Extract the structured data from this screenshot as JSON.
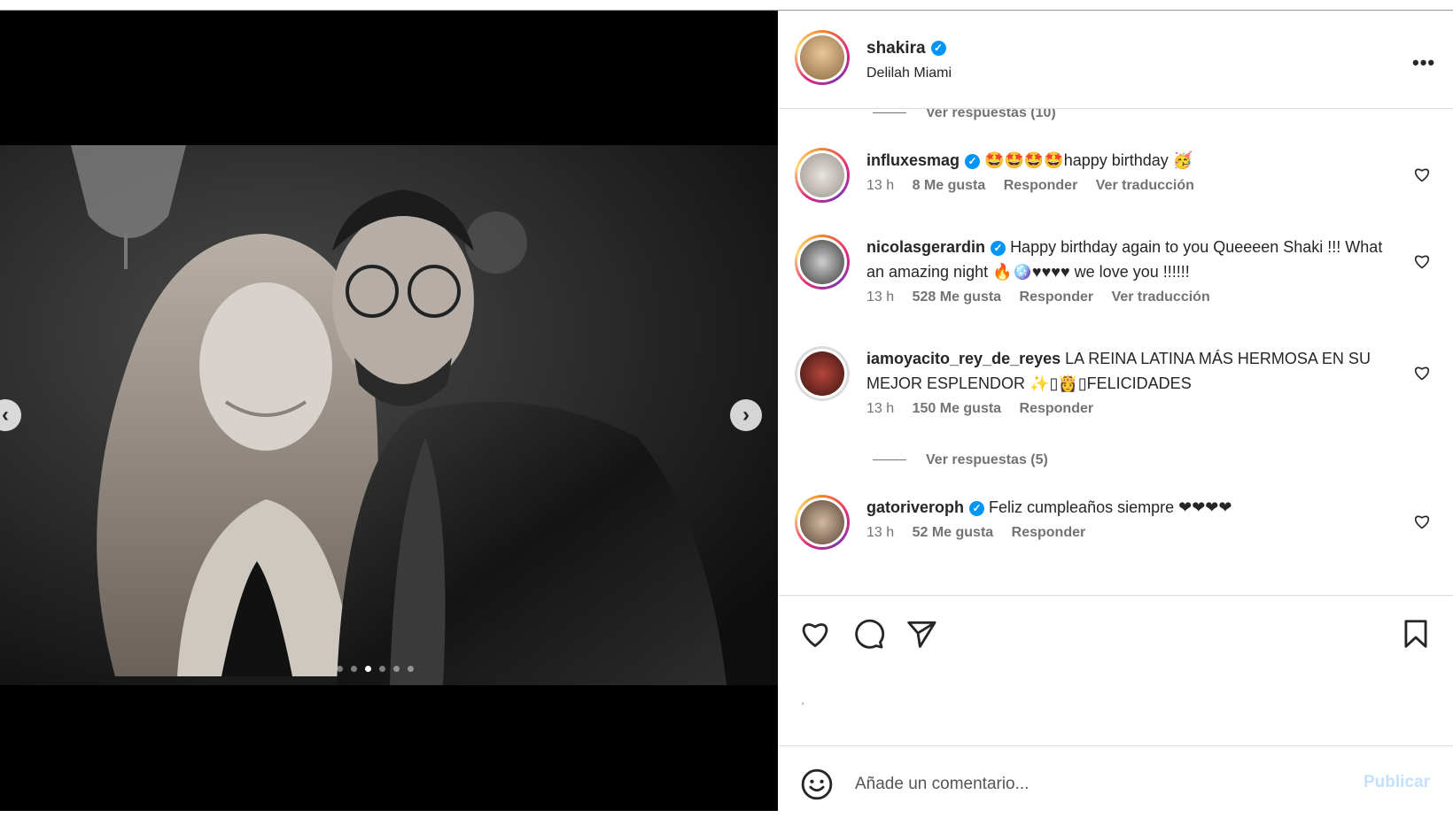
{
  "post": {
    "owner": "shakira",
    "location": "Delilah Miami",
    "more_icon": "more-options-icon",
    "carousel_dots": 6,
    "carousel_active_index": 2
  },
  "comments": {
    "prev_view_replies": "Ver respuestas (10)",
    "items": [
      {
        "user": "influxesmag",
        "verified": true,
        "text": "🤩🤩🤩🤩happy birthday 🥳",
        "time": "13 h",
        "likes": "8 Me gusta",
        "reply": "Responder",
        "translate": "Ver traducción"
      },
      {
        "user": "nicolasgerardin",
        "verified": true,
        "text": "Happy birthday again to you Queeeen Shaki !!! What an amazing night 🔥🪩♥♥♥♥ we love you !!!!!!",
        "time": "13 h",
        "likes": "528 Me gusta",
        "reply": "Responder",
        "translate": "Ver traducción"
      },
      {
        "user": "iamoyacito_rey_de_reyes",
        "verified": false,
        "text": "LA REINA LATINA MÁS HERMOSA EN SU MEJOR ESPLENDOR ✨▯👸▯FELICIDADES",
        "time": "13 h",
        "likes": "150 Me gusta",
        "reply": "Responder",
        "view_replies": "Ver respuestas (5)"
      },
      {
        "user": "gatoriveroph",
        "verified": true,
        "text": "Feliz cumpleaños siempre ❤❤❤❤",
        "time": "13 h",
        "likes": "52 Me gusta",
        "reply": "Responder"
      }
    ]
  },
  "actions": {
    "like_icon": "heart-icon",
    "comment_icon": "comment-icon",
    "share_icon": "send-icon",
    "save_icon": "bookmark-icon",
    "tiny_mark": "'"
  },
  "add_comment": {
    "placeholder": "Añade un comentario...",
    "publish_label": "Publicar",
    "emoji_icon": "emoji-icon"
  },
  "colors": {
    "verified": "#0095f6",
    "publish_disabled": "#c4e1fb",
    "muted_text": "#737373",
    "border": "#dbdbdb"
  }
}
